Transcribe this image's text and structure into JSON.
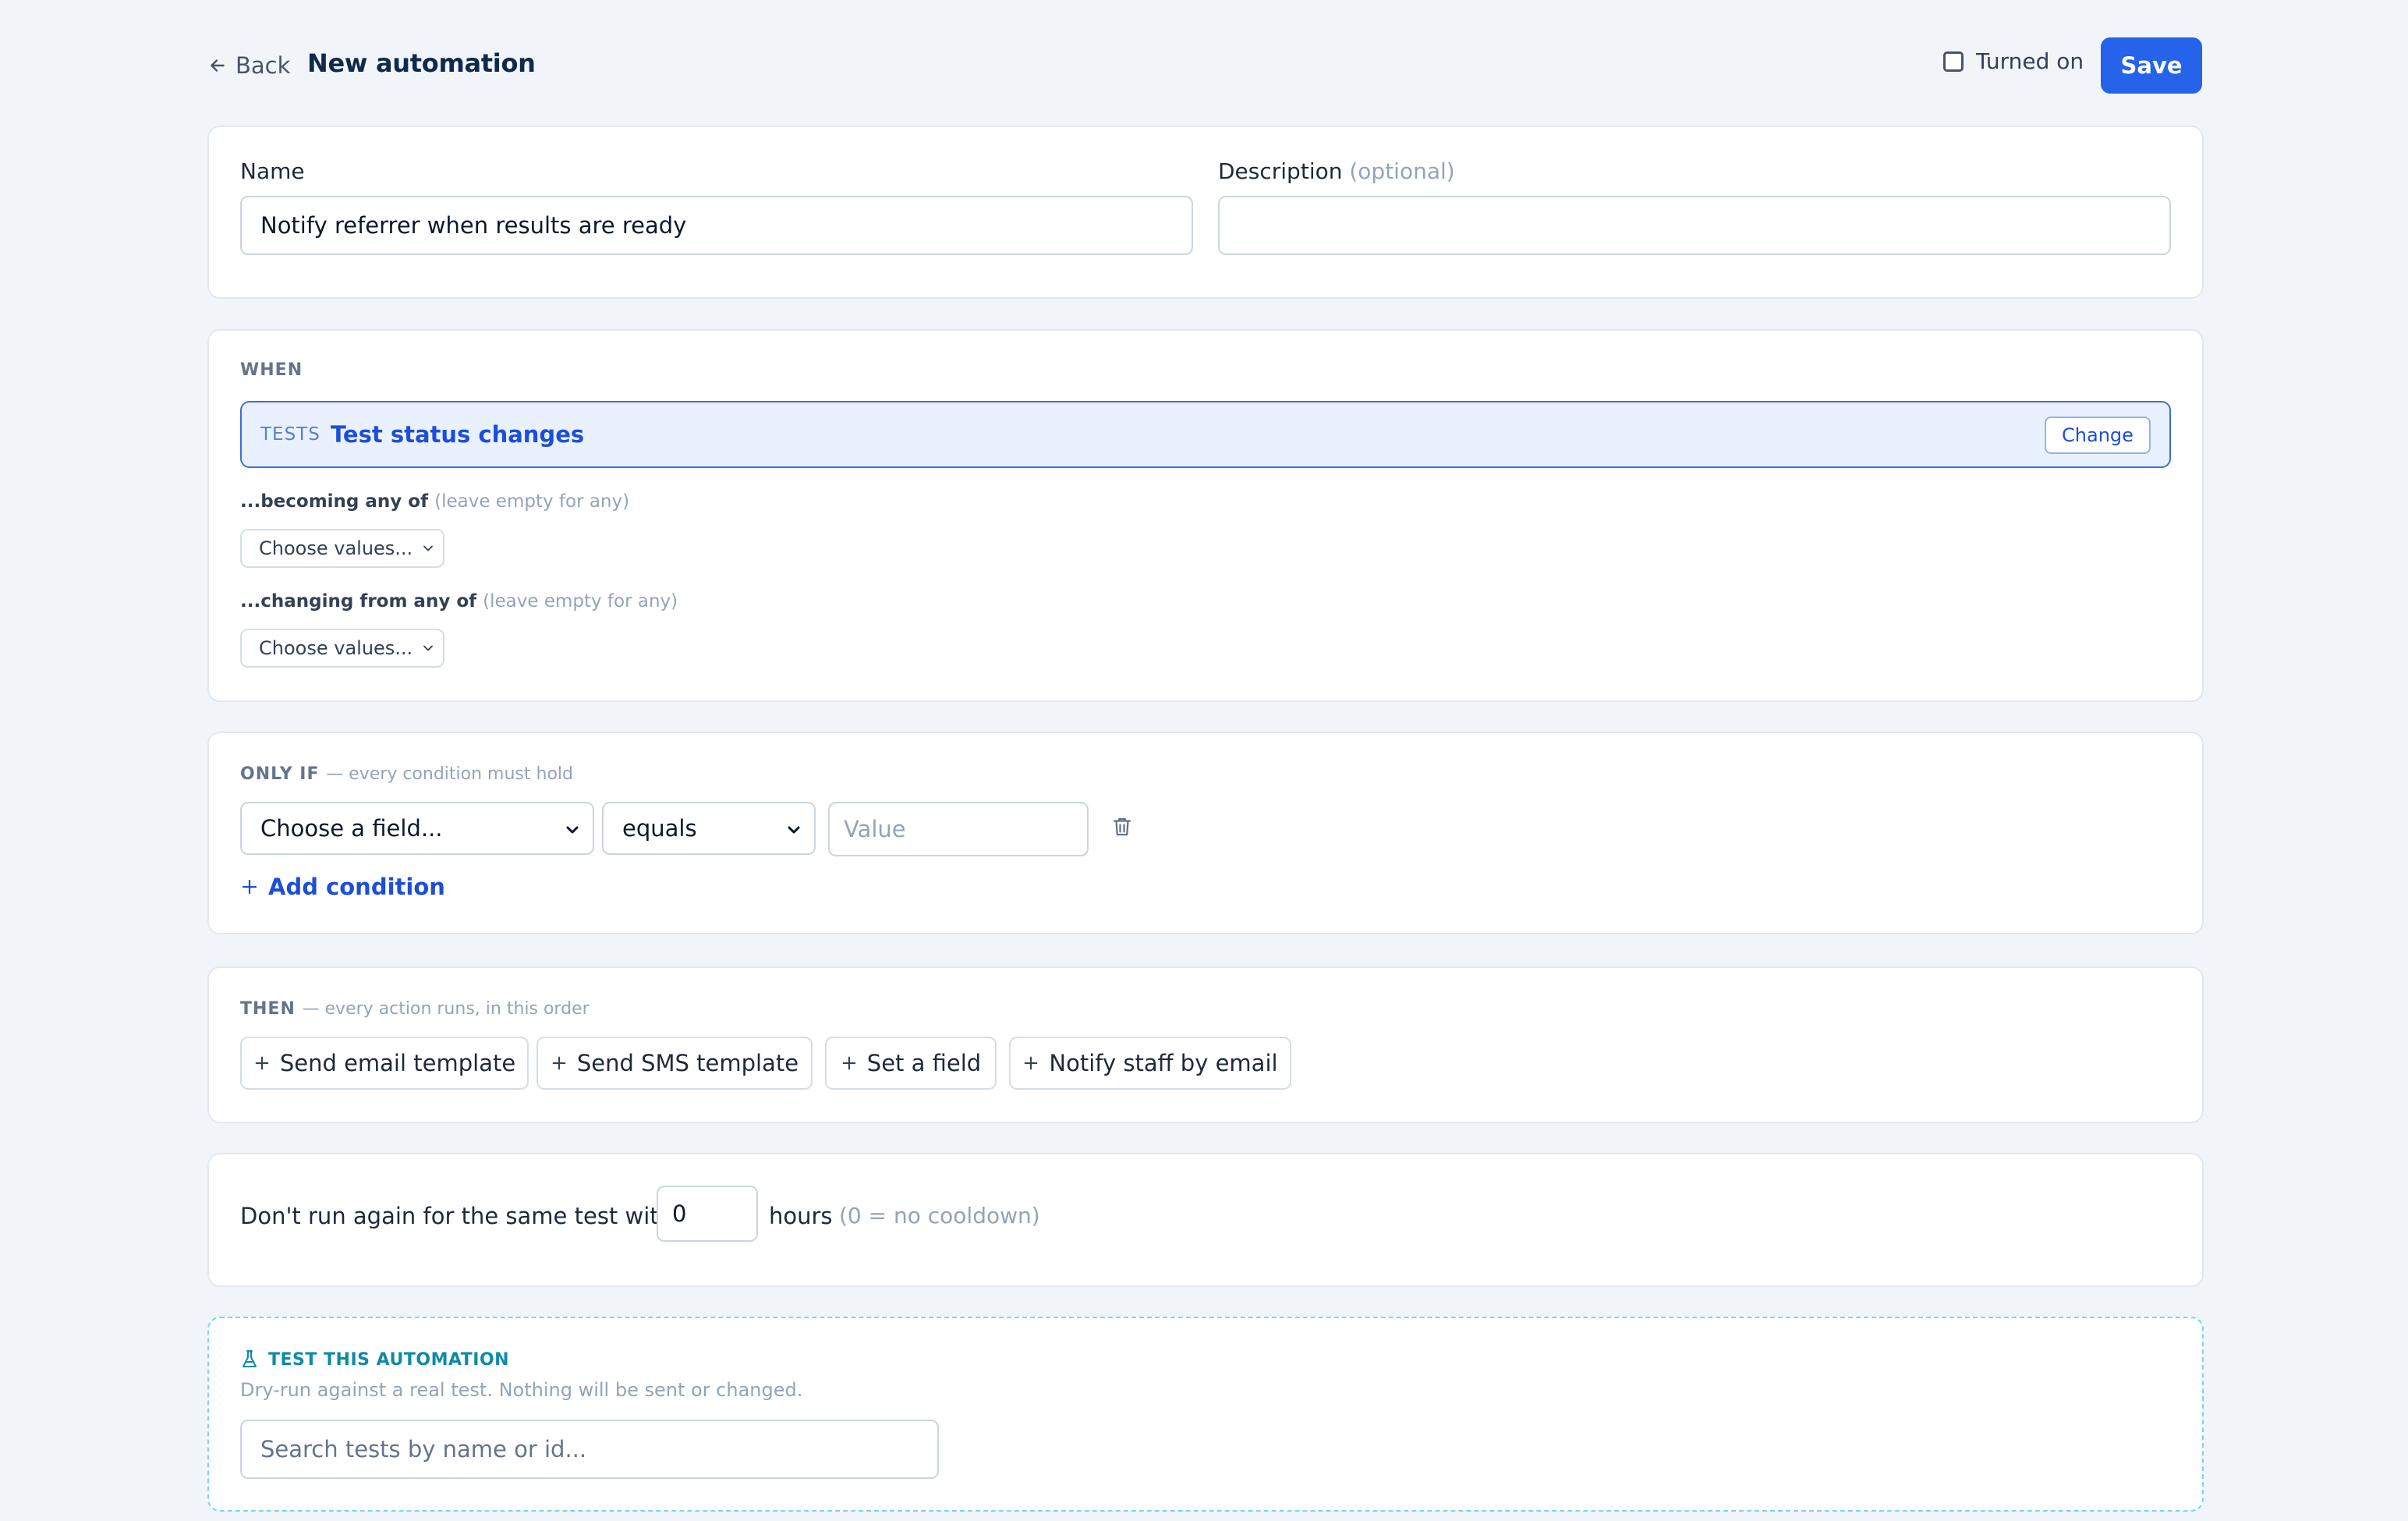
{
  "header": {
    "back_label": "Back",
    "title": "New automation",
    "toggle_label": "Turned on",
    "toggle_checked": false,
    "save_label": "Save"
  },
  "details": {
    "name_label": "Name",
    "name_value": "Notify referrer when results are ready",
    "description_label": "Description",
    "description_optional": "(optional)",
    "description_value": ""
  },
  "when": {
    "section_label": "WHEN",
    "trigger_tag": "TESTS",
    "trigger_text": "Test status changes",
    "change_label": "Change",
    "becoming_label": "...becoming any of",
    "becoming_hint": "(leave empty for any)",
    "becoming_button": "Choose values...",
    "changing_label": "...changing from any of",
    "changing_hint": "(leave empty for any)",
    "changing_button": "Choose values..."
  },
  "only_if": {
    "section_label": "ONLY IF",
    "section_hint": "— every condition must hold",
    "field_select": "Choose a field...",
    "operator_select": "equals",
    "value_placeholder": "Value",
    "add_condition_label": "Add condition"
  },
  "then": {
    "section_label": "THEN",
    "section_hint": "— every action runs, in this order",
    "actions": [
      {
        "label": "Send email template"
      },
      {
        "label": "Send SMS template"
      },
      {
        "label": "Set a field"
      },
      {
        "label": "Notify staff by email"
      }
    ]
  },
  "cooldown": {
    "text": "Don't run again for the same test within",
    "value": "0",
    "unit": "hours",
    "hint": "(0 = no cooldown)"
  },
  "test": {
    "heading": "TEST THIS AUTOMATION",
    "subtext": "Dry-run against a real test. Nothing will be sent or changed.",
    "search_placeholder": "Search tests by name or id..."
  },
  "colors": {
    "accent": "#2563eb",
    "page_background": "#f1f4f9",
    "trigger_background": "#eaf1fe",
    "test_accent": "#0e8aa8"
  },
  "icons": [
    "arrow-left-icon",
    "plus-icon",
    "chevron-down-icon",
    "trash-icon",
    "flask-icon"
  ]
}
